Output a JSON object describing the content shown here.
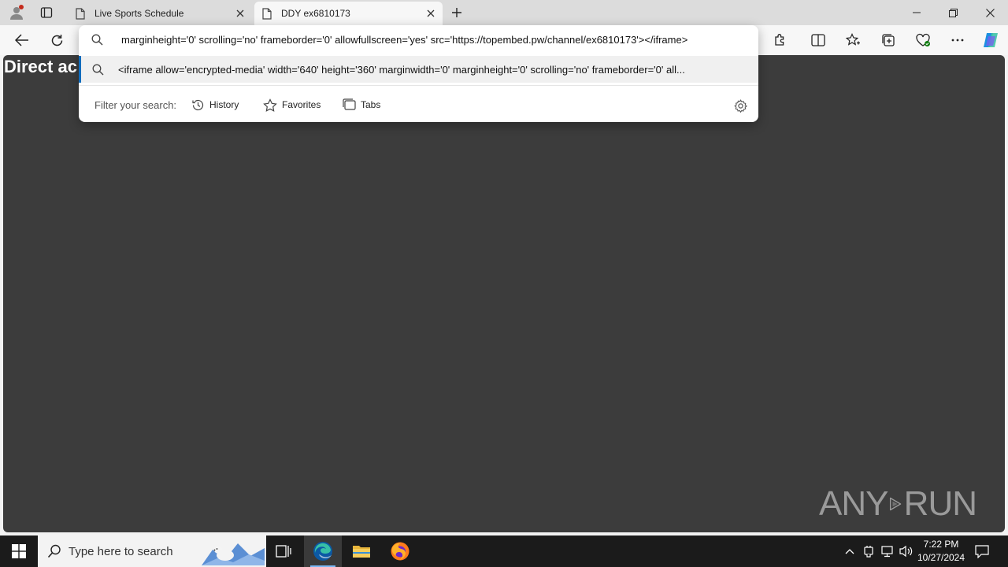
{
  "browser": {
    "tabs": [
      {
        "title": "Live Sports Schedule",
        "active": false
      },
      {
        "title": "DDY ex6810173",
        "active": true
      }
    ],
    "omnibox": {
      "input_text": "marginheight='0' scrolling='no' frameborder='0' allowfullscreen='yes' src='https://topembed.pw/channel/ex6810173'></iframe>",
      "suggestion_text": "<iframe allow='encrypted-media' width='640' height='360' marginwidth='0' marginheight='0' scrolling='no' frameborder='0' all...",
      "filter_label": "Filter your search:",
      "filters": {
        "history": "History",
        "favorites": "Favorites",
        "tabs": "Tabs"
      }
    }
  },
  "page": {
    "heading": "Direct ac",
    "watermark": {
      "left": "ANY",
      "right": "RUN"
    }
  },
  "taskbar": {
    "search_placeholder": "Type here to search",
    "time": "7:22 PM",
    "date": "10/27/2024"
  },
  "colors": {
    "accent": "#0f6cbd",
    "page_background": "#3c3c3c",
    "taskbar": "#1b1b1b"
  }
}
